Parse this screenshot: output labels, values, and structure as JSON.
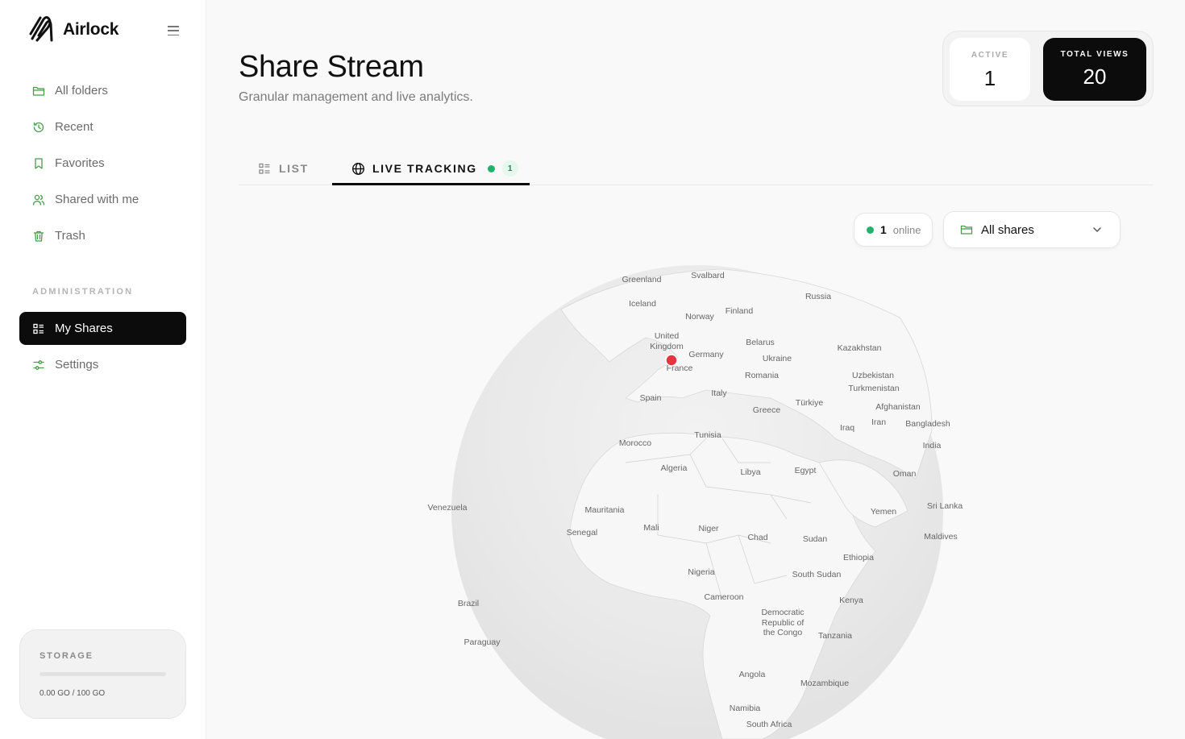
{
  "sidebar": {
    "brand": "Airlock",
    "items": [
      {
        "label": "All folders",
        "icon": "folder-icon"
      },
      {
        "label": "Recent",
        "icon": "history-icon"
      },
      {
        "label": "Favorites",
        "icon": "bookmark-icon"
      },
      {
        "label": "Shared with me",
        "icon": "users-icon"
      },
      {
        "label": "Trash",
        "icon": "trash-icon"
      }
    ],
    "section_label": "ADMINISTRATION",
    "admin_items": [
      {
        "label": "My Shares",
        "icon": "list-icon",
        "active": true
      },
      {
        "label": "Settings",
        "icon": "sliders-icon"
      }
    ],
    "storage": {
      "label": "STORAGE",
      "usage_text": "0.00 GO / 100 GO",
      "used_fraction": 0
    }
  },
  "header": {
    "title": "Share Stream",
    "subtitle": "Granular management and live analytics."
  },
  "stats": {
    "active_label": "ACTIVE",
    "active_value": "1",
    "total_label": "TOTAL VIEWS",
    "total_value": "20"
  },
  "tabs": {
    "list_label": "LIST",
    "live_label": "LIVE TRACKING",
    "live_count": "1"
  },
  "toolbar": {
    "online_count": "1",
    "online_text": "online",
    "filter_value": "All shares"
  },
  "map": {
    "countries": [
      "Greenland",
      "Svalbard",
      "Russia",
      "Iceland",
      "Finland",
      "Norway",
      "United",
      "Kingdom",
      "Belarus",
      "Germany",
      "Kazakhstan",
      "Ukraine",
      "France",
      "Romania",
      "Uzbekistan",
      "Turkmenistan",
      "Italy",
      "Türkiye",
      "Spain",
      "Afghanistan",
      "Greece",
      "Iraq",
      "Iran",
      "Bangladesh",
      "India",
      "Tunisia",
      "Morocco",
      "Algeria",
      "Libya",
      "Egypt",
      "Oman",
      "Venezuela",
      "Sri Lanka",
      "Mauritania",
      "Yemen",
      "Maldives",
      "Senegal",
      "Mali",
      "Niger",
      "Chad",
      "Sudan",
      "Ethiopia",
      "Nigeria",
      "South Sudan",
      "Kenya",
      "Cameroon",
      "Brazil",
      "Democratic",
      "Republic of",
      "the Congo",
      "Tanzania",
      "Paraguay",
      "Angola",
      "Mozambique",
      "Namibia",
      "South Africa"
    ],
    "marker_color": "#e5343f",
    "marker_location": "France"
  },
  "colors": {
    "accent": "#0c0c0c",
    "online": "#23b26d",
    "marker": "#e5343f"
  }
}
